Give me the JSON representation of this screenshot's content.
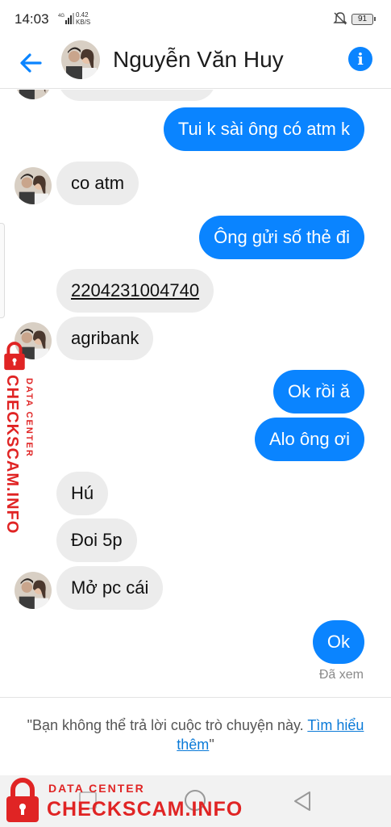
{
  "status": {
    "time": "14:03",
    "network": "4G",
    "speed_value": "0.42",
    "speed_unit": "KB/S",
    "battery": "91"
  },
  "header": {
    "contact_name": "Nguyễn Văn Huy",
    "back_icon": "back-arrow-icon",
    "info_icon": "info-icon",
    "info_glyph": "i"
  },
  "messages": [
    {
      "side": "out",
      "text": "Tui k sài ông có atm k"
    },
    {
      "side": "in",
      "text": "co atm"
    },
    {
      "side": "out",
      "text": "Ông gửi số thẻ đi"
    },
    {
      "side": "in",
      "text": "2204231004740"
    },
    {
      "side": "in",
      "text": "agribank"
    },
    {
      "side": "out",
      "text": "Ok rồi ă"
    },
    {
      "side": "out",
      "text": "Alo ông ơi"
    },
    {
      "side": "in",
      "text": "Hú"
    },
    {
      "side": "in",
      "text": "Đoi 5p"
    },
    {
      "side": "in",
      "text": "Mở  pc cái"
    },
    {
      "side": "out",
      "text": "Ok"
    }
  ],
  "seen_label": "Đã xem",
  "notice": {
    "text": "\"Bạn không thể trả lời cuộc trò chuyện này. ",
    "link": "Tìm hiểu thêm",
    "end": "\""
  },
  "watermark": {
    "small": "DATA CENTER",
    "big": "CHECKSCAM.INFO",
    "color": "#e02424"
  },
  "colors": {
    "accent": "#0a84ff",
    "incoming_bubble": "#ececec"
  }
}
